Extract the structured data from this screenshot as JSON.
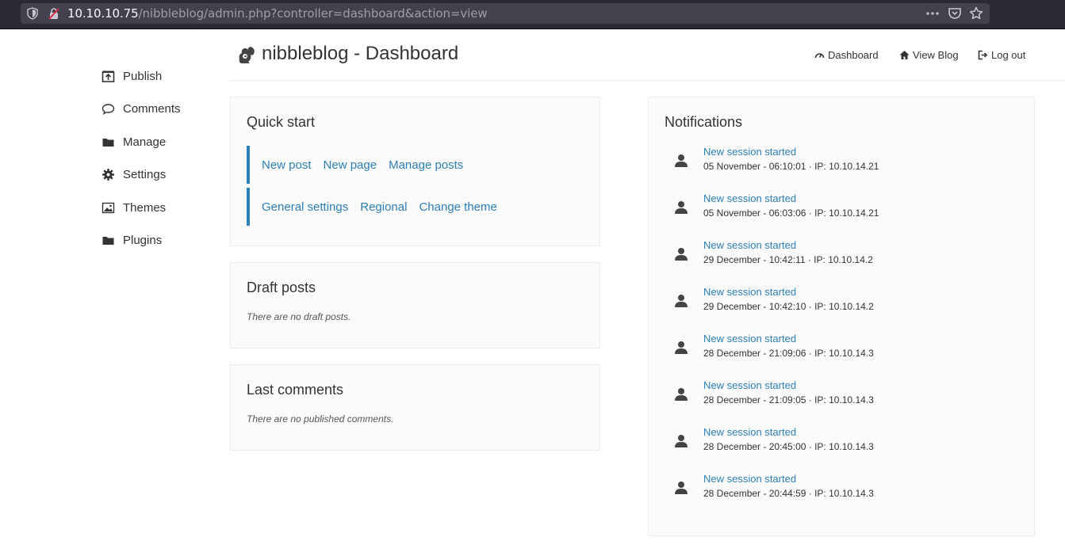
{
  "browser": {
    "url_host": "10.10.10.75",
    "url_path": "/nibbleblog/admin.php?controller=dashboard&action=view"
  },
  "sidebar": {
    "items": [
      {
        "label": "Publish",
        "icon": "publish-icon"
      },
      {
        "label": "Comments",
        "icon": "comment-icon"
      },
      {
        "label": "Manage",
        "icon": "folder-icon"
      },
      {
        "label": "Settings",
        "icon": "gear-icon"
      },
      {
        "label": "Themes",
        "icon": "image-icon"
      },
      {
        "label": "Plugins",
        "icon": "folder-icon"
      }
    ]
  },
  "header": {
    "title": "nibbleblog - Dashboard",
    "nav": [
      {
        "label": "Dashboard",
        "icon": "dashboard-icon"
      },
      {
        "label": "View Blog",
        "icon": "home-icon"
      },
      {
        "label": "Log out",
        "icon": "logout-icon"
      }
    ]
  },
  "quick_start": {
    "title": "Quick start",
    "row1": [
      "New post",
      "New page",
      "Manage posts"
    ],
    "row2": [
      "General settings",
      "Regional",
      "Change theme"
    ]
  },
  "draft_posts": {
    "title": "Draft posts",
    "empty": "There are no draft posts."
  },
  "last_comments": {
    "title": "Last comments",
    "empty": "There are no published comments."
  },
  "notifications": {
    "title": "Notifications",
    "items": [
      {
        "title": "New session started",
        "meta": "05 November - 06:10:01 · IP: 10.10.14.21"
      },
      {
        "title": "New session started",
        "meta": "05 November - 06:03:06 · IP: 10.10.14.21"
      },
      {
        "title": "New session started",
        "meta": "29 December - 10:42:11 · IP: 10.10.14.2"
      },
      {
        "title": "New session started",
        "meta": "29 December - 10:42:10 · IP: 10.10.14.2"
      },
      {
        "title": "New session started",
        "meta": "28 December - 21:09:06 · IP: 10.10.14.3"
      },
      {
        "title": "New session started",
        "meta": "28 December - 21:09:05 · IP: 10.10.14.3"
      },
      {
        "title": "New session started",
        "meta": "28 December - 20:45:00 · IP: 10.10.14.3"
      },
      {
        "title": "New session started",
        "meta": "28 December - 20:44:59 · IP: 10.10.14.3"
      }
    ]
  },
  "colors": {
    "link": "#2a7fb8",
    "panel_bg": "#fbfbfb",
    "chrome_bg": "#2b2a33"
  }
}
